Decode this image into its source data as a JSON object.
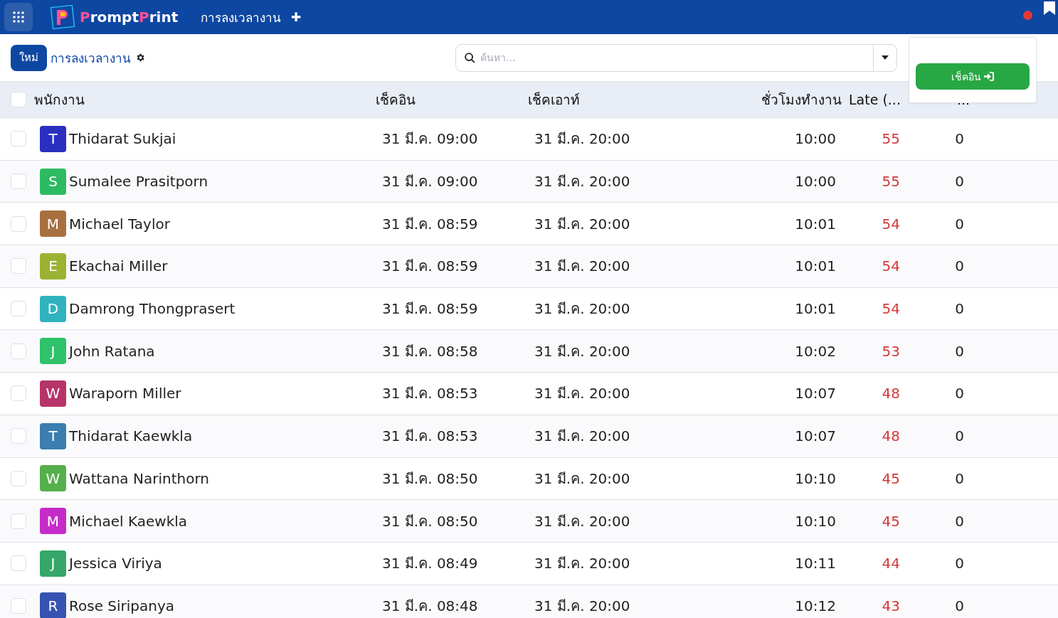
{
  "topbar": {
    "brand": {
      "first": "Prompt",
      "second": "Print"
    },
    "title": "การลงเวลางาน",
    "add": "✚"
  },
  "controlbar": {
    "new_button": "ใหม่",
    "breadcrumb": "การลงเวลางาน",
    "search": {
      "placeholder": "ค้นหา..."
    }
  },
  "popup": {
    "button": "เช็คอิน"
  },
  "table": {
    "select_all": false,
    "columns": [
      "พนักงาน",
      "เช็คอิน",
      "เช็คเอาท์",
      "ชั่วโมงทำงาน",
      "Late (...",
      "..."
    ],
    "rows": [
      {
        "initial": "T",
        "color": "#2a2fbf",
        "name": "Thidarat Sukjai",
        "check_in": "31 มี.ค. 09:00",
        "check_out": "31 มี.ค. 20:00",
        "hours": "10:00",
        "late": "55",
        "early": "0",
        "checked": false
      },
      {
        "initial": "S",
        "color": "#2dbb62",
        "name": "Sumalee Prasitporn",
        "check_in": "31 มี.ค. 09:00",
        "check_out": "31 มี.ค. 20:00",
        "hours": "10:00",
        "late": "55",
        "early": "0",
        "checked": false
      },
      {
        "initial": "M",
        "color": "#a8703f",
        "name": "Michael Taylor",
        "check_in": "31 มี.ค. 08:59",
        "check_out": "31 มี.ค. 20:00",
        "hours": "10:01",
        "late": "54",
        "early": "0",
        "checked": false
      },
      {
        "initial": "E",
        "color": "#9bb233",
        "name": "Ekachai Miller",
        "check_in": "31 มี.ค. 08:59",
        "check_out": "31 มี.ค. 20:00",
        "hours": "10:01",
        "late": "54",
        "early": "0",
        "checked": false
      },
      {
        "initial": "D",
        "color": "#2fb3be",
        "name": "Damrong Thongprasert",
        "check_in": "31 มี.ค. 08:59",
        "check_out": "31 มี.ค. 20:00",
        "hours": "10:01",
        "late": "54",
        "early": "0",
        "checked": false
      },
      {
        "initial": "J",
        "color": "#2ec26a",
        "name": "John Ratana",
        "check_in": "31 มี.ค. 08:58",
        "check_out": "31 มี.ค. 20:00",
        "hours": "10:02",
        "late": "53",
        "early": "0",
        "checked": false
      },
      {
        "initial": "W",
        "color": "#b63469",
        "name": "Waraporn Miller",
        "check_in": "31 มี.ค. 08:53",
        "check_out": "31 มี.ค. 20:00",
        "hours": "10:07",
        "late": "48",
        "early": "0",
        "checked": false
      },
      {
        "initial": "T",
        "color": "#3b7eaf",
        "name": "Thidarat Kaewkla",
        "check_in": "31 มี.ค. 08:53",
        "check_out": "31 มี.ค. 20:00",
        "hours": "10:07",
        "late": "48",
        "early": "0",
        "checked": false
      },
      {
        "initial": "W",
        "color": "#54b04a",
        "name": "Wattana Narinthorn",
        "check_in": "31 มี.ค. 08:50",
        "check_out": "31 มี.ค. 20:00",
        "hours": "10:10",
        "late": "45",
        "early": "0",
        "checked": false
      },
      {
        "initial": "M",
        "color": "#c52bc9",
        "name": "Michael Kaewkla",
        "check_in": "31 มี.ค. 08:50",
        "check_out": "31 มี.ค. 20:00",
        "hours": "10:10",
        "late": "45",
        "early": "0",
        "checked": false
      },
      {
        "initial": "J",
        "color": "#35a768",
        "name": "Jessica Viriya",
        "check_in": "31 มี.ค. 08:49",
        "check_out": "31 มี.ค. 20:00",
        "hours": "10:11",
        "late": "44",
        "early": "0",
        "checked": false
      },
      {
        "initial": "R",
        "color": "#3653b3",
        "name": "Rose Siripanya",
        "check_in": "31 มี.ค. 08:48",
        "check_out": "31 มี.ค. 20:00",
        "hours": "10:12",
        "late": "43",
        "early": "0",
        "checked": false
      }
    ]
  }
}
